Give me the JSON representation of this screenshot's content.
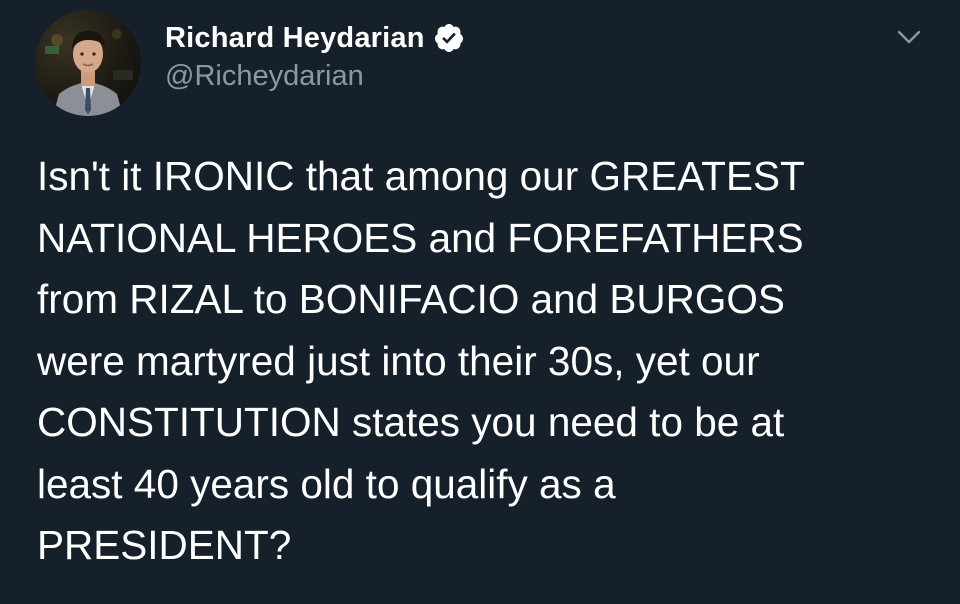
{
  "author": {
    "display_name": "Richard Heydarian",
    "handle": "@Richeydarian",
    "verified": true,
    "avatar_icon": "profile-photo"
  },
  "menu": {
    "icon": "chevron-down-icon"
  },
  "tweet": {
    "text": "Isn't it IRONIC that among our GREATEST\nNATIONAL HEROES and FOREFATHERS\nfrom RIZAL to BONIFACIO and BURGOS\nwere martyred just into their 30s, yet our\nCONSTITUTION states you need to be at\nleast 40 years old to qualify as a\nPRESIDENT?"
  },
  "colors": {
    "background": "#15202b",
    "primary_text": "#ffffff",
    "secondary_text": "#8899a6",
    "verified_badge": "#ffffff"
  }
}
